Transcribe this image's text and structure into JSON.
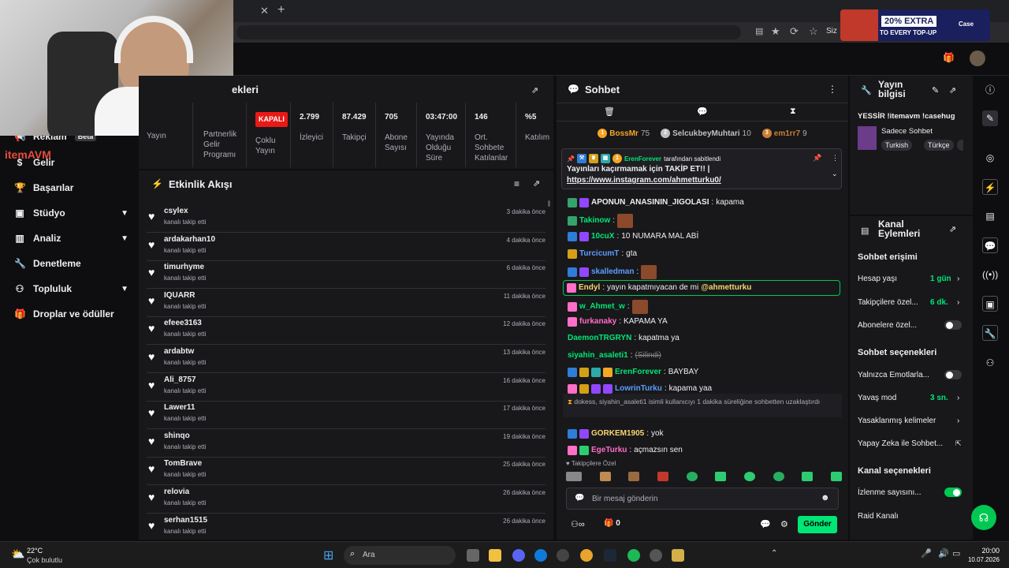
{
  "browser": {
    "address_prefix": "Siz",
    "ad_text": "20% EXTRA",
    "ad_sub": "TO EVERY TOP-UP",
    "ad_brand": "Case"
  },
  "logo": {
    "brand": "itemAVM"
  },
  "nav": {
    "reklam": "Reklam",
    "beta": "Beta",
    "items": [
      {
        "label": "Gelir",
        "icon": "dollar-icon"
      },
      {
        "label": "Başarılar",
        "icon": "trophy-icon"
      },
      {
        "label": "Stüdyo",
        "icon": "studio-icon"
      },
      {
        "label": "Analiz",
        "icon": "chart-icon"
      },
      {
        "label": "Denetleme",
        "icon": "wrench-icon"
      },
      {
        "label": "Topluluk",
        "icon": "community-icon"
      },
      {
        "label": "Droplar ve ödüller",
        "icon": "gift-icon"
      }
    ]
  },
  "stats": {
    "title_tail": "ekleri",
    "yayin": "Yayın",
    "partner_label": "Partnerlik Gelir Programı",
    "coklu_status": "KAPALI",
    "coklu_label": "Çoklu Yayın",
    "items": [
      {
        "value": "2.799",
        "label": "İzleyici"
      },
      {
        "value": "87.429",
        "label": "Takipçi"
      },
      {
        "value": "705",
        "label": "Abone Sayısı"
      },
      {
        "value": "03:47:00",
        "label": "Yayında Olduğu Süre"
      },
      {
        "value": "146",
        "label": "Ort. Sohbete Katılanlar"
      },
      {
        "value": "%5",
        "label": "Katılım"
      }
    ]
  },
  "activity": {
    "title": "Etkinlik Akışı",
    "action": "kanalı takip etti",
    "rows": [
      {
        "user": "csylex",
        "time": "3 dakika önce"
      },
      {
        "user": "ardakarhan10",
        "time": "4 dakika önce"
      },
      {
        "user": "timurhyme",
        "time": "6 dakika önce"
      },
      {
        "user": "IQUARR",
        "time": "11 dakika önce"
      },
      {
        "user": "efeee3163",
        "time": "12 dakika önce"
      },
      {
        "user": "ardabtw",
        "time": "13 dakika önce"
      },
      {
        "user": "Ali_8757",
        "time": "16 dakika önce"
      },
      {
        "user": "Lawer11",
        "time": "17 dakika önce"
      },
      {
        "user": "shinqo",
        "time": "19 dakika önce"
      },
      {
        "user": "TomBrave",
        "time": "25 dakika önce"
      },
      {
        "user": "relovia",
        "time": "26 dakika önce"
      },
      {
        "user": "serhan1515",
        "time": "26 dakika önce"
      }
    ]
  },
  "chat": {
    "title": "Sohbet",
    "leaders": [
      {
        "rank": "1",
        "name": "BossMr",
        "count": "75",
        "color": "#f5a623"
      },
      {
        "rank": "2",
        "name": "SelcukbeyMuhtari",
        "count": "10",
        "color": "#c0c0c0"
      },
      {
        "rank": "3",
        "name": "em1rr7",
        "count": "9",
        "color": "#cd7f32"
      }
    ],
    "pinned_by": "ErenForever",
    "pinned_suffix": "tarafından sabitlendi",
    "pinned_text": "Yayınları kaçırmamak için TAKİP ET!! |",
    "pinned_link": "https://www.instagram.com/ahmetturku0/",
    "messages": [
      {
        "user": "APONUN_ANASININ_JIGOLASI",
        "text": "kapama",
        "color": "#efeff1",
        "emote": false
      },
      {
        "user": "Takinow",
        "text": "",
        "color": "#00e676",
        "emote": true
      },
      {
        "user": "10cuX",
        "text": "10 NUMARA MAL ABİ",
        "color": "#00e676",
        "emote": false
      },
      {
        "user": "TurcicumT",
        "text": "gta",
        "color": "#5c9dff",
        "emote": false
      },
      {
        "user": "skalledman",
        "text": "",
        "color": "#5c9dff",
        "emote": true
      },
      {
        "user": "Endyl",
        "text": "yayın kapatmıyacan de mi",
        "mention": "@ahmetturku",
        "color": "#f5d76e",
        "emote": false
      },
      {
        "user": "w_Ahmet_w",
        "text": "",
        "color": "#00e676",
        "emote": true
      },
      {
        "user": "furkanaky",
        "text": "KAPAMA YA",
        "color": "#ff6ec7",
        "emote": false
      },
      {
        "user": "DaemonTRGRYN",
        "text": "kapatma ya",
        "color": "#00e676",
        "emote": false
      },
      {
        "user": "siyahin_asaleti1",
        "text": "(Silindi)",
        "color": "#00e676",
        "emote": false
      },
      {
        "user": "ErenForever",
        "text": "BAYBAY",
        "color": "#00e676",
        "emote": false
      },
      {
        "user": "LowrinTurku",
        "text": "kapama yaa",
        "color": "#5c9dff",
        "emote": false
      },
      {
        "user": "GORKEM1905",
        "text": "yok",
        "color": "#f5d76e",
        "emote": false
      },
      {
        "user": "EgeTurku",
        "text": "açmazsın sen",
        "color": "#ff6ec7",
        "emote": false
      }
    ],
    "timeout_text": "dokess, siyahin_asaleti1 isimli kullanıcıyı 1 dakika süreliğine sohbetten uzaklaştırdı",
    "followers_only": "Takipçilere Özel",
    "placeholder": "Bir mesaj gönderin",
    "points": "0",
    "send": "Gönder"
  },
  "stream_info": {
    "title": "Yayın bilgisi",
    "stream_title": "YESSİR !itemavm !casehug",
    "category": "Sadece Sohbet",
    "tags": [
      "Turkish",
      "Türkçe"
    ]
  },
  "channel_actions": {
    "title": "Kanal Eylemleri",
    "chat_access": "Sohbet erişimi",
    "account_age_label": "Hesap yaşı",
    "account_age_value": "1 gün",
    "followers_label": "Takipçilere özel...",
    "followers_value": "6 dk.",
    "subs_label": "Abonelere özel...",
    "chat_options": "Sohbet seçenekleri",
    "emote_only": "Yalnızca Emotlarla...",
    "slow_label": "Yavaş mod",
    "slow_value": "3 sn.",
    "banned_words": "Yasaklanmış kelimeler",
    "ai_label": "Yapay Zeka ile Sohbet...",
    "channel_options": "Kanal seçenekleri",
    "viewer_count": "İzlenme sayısını...",
    "raid": "Raid Kanalı"
  },
  "taskbar": {
    "temp": "22°C",
    "weather": "Çok bulutlu",
    "search": "Ara",
    "time": "20:00",
    "date": "10.07.2026"
  }
}
